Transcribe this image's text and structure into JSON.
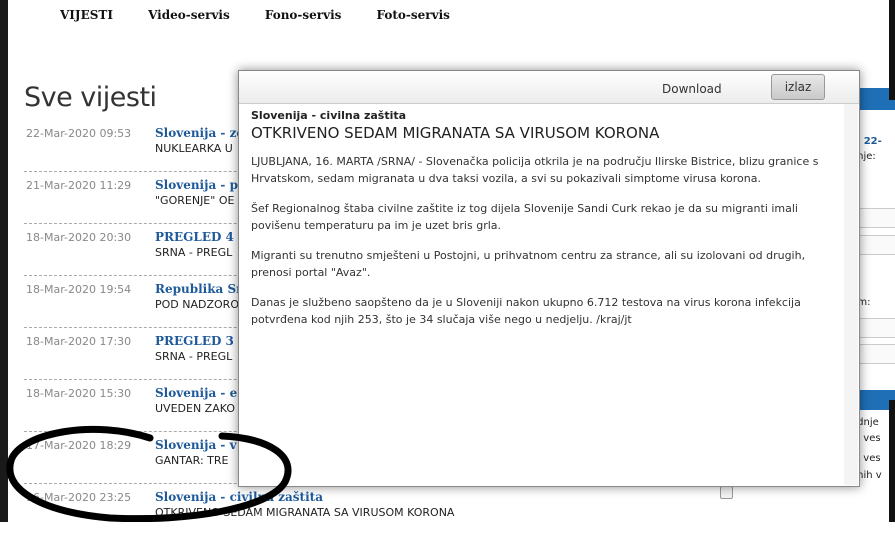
{
  "topnav": [
    "VIJESTI",
    "Video-servis",
    "Fono-servis",
    "Foto-servis"
  ],
  "page_title": "Sve vijesti",
  "news": [
    {
      "date": "22-Mar-2020 09:53",
      "category": "Slovenija - ze",
      "headline": "NUKLEARKA U"
    },
    {
      "date": "21-Mar-2020 11:29",
      "category": "Slovenija - p",
      "headline": "\"GORENJE\" OE"
    },
    {
      "date": "18-Mar-2020 20:30",
      "category": "PREGLED 4",
      "headline": "SRNA - PREGL"
    },
    {
      "date": "18-Mar-2020 19:54",
      "category": "Republika Sr",
      "headline": "POD NADZORO"
    },
    {
      "date": "18-Mar-2020 17:30",
      "category": "PREGLED 3",
      "headline": "SRNA - PREGL"
    },
    {
      "date": "18-Mar-2020 15:30",
      "category": "Slovenija - e",
      "headline": "UVEDEN ZAKO"
    },
    {
      "date": "17-Mar-2020 18:29",
      "category": "Slovenija - v",
      "headline": "GANTAR: TRE"
    },
    {
      "date": "16-Mar-2020 23:25",
      "category": "Slovenija - civilna zaštita",
      "headline": "OTKRIVENO SEDAM MIGRANATA SA VIRUSOM KORONA"
    }
  ],
  "modal": {
    "download_label": "Download",
    "close_label": "izlaz",
    "category": "Slovenija - civilna zaštita",
    "title": "OTKRIVENO SEDAM MIGRANATA SA VIRUSOM KORONA",
    "paragraphs": [
      "LJUBLJANA, 16. MARTA /SRNA/ - Slovenačka policija otkrila je na području Ilirske Bistrice, blizu granice s Hrvatskom, sedam migranata u dva taksi vozila, a svi su pokazivali simptome virusa korona.",
      "Šef Regionalnog štaba civilne zaštite iz tog dijela Slovenije Sandi Curk rekao je da su migranti imali povišenu temperaturu pa im je uzet bris grla.",
      "Migranti su trenutno smješteni u Postojni, u prihvatnom centru za strance, ali su izolovani od drugih, prenosi portal \"Avaz\".",
      "Danas je službeno saopšteno da je u Sloveniji nakon ukupno 6.712 testova na virus korona infekcija potvrđena kod njih 253, što je 34 slučaja više nego u nedjelju. /kraj/jt"
    ]
  },
  "right_panel": {
    "line1_prefix": "e:",
    "line1_link": "22-",
    "line2": "anje:",
    "line3": "um:",
    "list": [
      "ednje",
      "ih ves",
      "ih ves",
      "anih v"
    ]
  },
  "colors": {
    "link": "#1e5a9a",
    "accent": "#1e6fb5"
  }
}
